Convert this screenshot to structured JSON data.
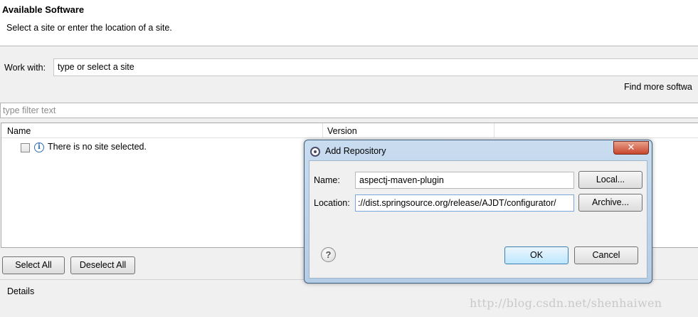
{
  "header": {
    "title": "Available Software",
    "subtitle": "Select a site or enter the location of a site."
  },
  "work_with": {
    "label": "Work with:",
    "value": "type or select a site"
  },
  "find_more_link": "Find more softwa",
  "filter": {
    "placeholder": "type filter text"
  },
  "table": {
    "columns": [
      "Name",
      "Version"
    ],
    "rows": [
      {
        "text": "There is no site selected.",
        "icon": "info-icon",
        "checked": false
      }
    ]
  },
  "buttons": {
    "select_all": "Select All",
    "deselect_all": "Deselect All"
  },
  "details": {
    "label": "Details"
  },
  "dialog": {
    "title": "Add Repository",
    "close_symbol": "✕",
    "name_label": "Name:",
    "name_value": "aspectj-maven-plugin",
    "location_label": "Location:",
    "location_value": "://dist.springsource.org/release/AJDT/configurator/",
    "local_button": "Local...",
    "archive_button": "Archive...",
    "ok_button": "OK",
    "cancel_button": "Cancel",
    "help_symbol": "?"
  },
  "watermark": "http://blog.csdn.net/shenhaiwen"
}
